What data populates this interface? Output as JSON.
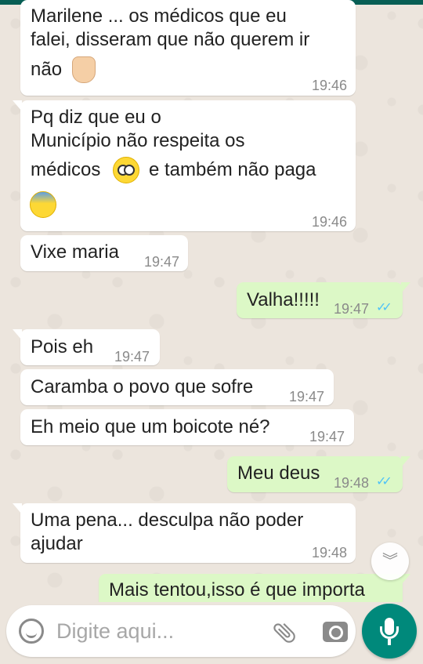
{
  "chat": {
    "messages": [
      {
        "dir": "in",
        "lines": [
          "Marilene ... os médicos que eu",
          "falei, disseram que não querem ir",
          "não"
        ],
        "emoji": "thumbs-down",
        "time": "19:46"
      },
      {
        "dir": "in",
        "lines": [
          "Pq diz que eu o",
          "Município não respeita os",
          "médicos",
          "e também não paga"
        ],
        "emoji": "flushed-face",
        "emoji2": "anxious-sweat-face",
        "time": "19:46"
      },
      {
        "dir": "in",
        "lines": [
          "Vixe maria"
        ],
        "time": "19:47"
      },
      {
        "dir": "out",
        "lines": [
          "Valha!!!!!"
        ],
        "time": "19:47",
        "status": "read"
      },
      {
        "dir": "in",
        "lines": [
          "Pois eh"
        ],
        "time": "19:47"
      },
      {
        "dir": "in",
        "lines": [
          "Caramba o povo que sofre"
        ],
        "time": "19:47"
      },
      {
        "dir": "in",
        "lines": [
          "Eh meio que um boicote né?"
        ],
        "time": "19:47"
      },
      {
        "dir": "out",
        "lines": [
          "Meu deus"
        ],
        "time": "19:48",
        "status": "read"
      },
      {
        "dir": "in",
        "lines": [
          "Uma pena... desculpa não poder",
          "ajudar"
        ],
        "time": "19:48"
      },
      {
        "dir": "out",
        "lines": [
          "Mais tentou,isso é que importa"
        ],
        "time": ""
      }
    ]
  },
  "input": {
    "placeholder": "Digite aqui..."
  },
  "icons": {
    "emoji_button": "smiley-icon",
    "attach": "paperclip-icon",
    "camera": "camera-icon",
    "mic": "microphone-icon",
    "scroll_down": "double-chevron-down-icon"
  },
  "colors": {
    "incoming": "#ffffff",
    "outgoing": "#dcf8c6",
    "accent": "#00897b",
    "read_ticks": "#4fc3f7",
    "background": "#ece5dd"
  }
}
